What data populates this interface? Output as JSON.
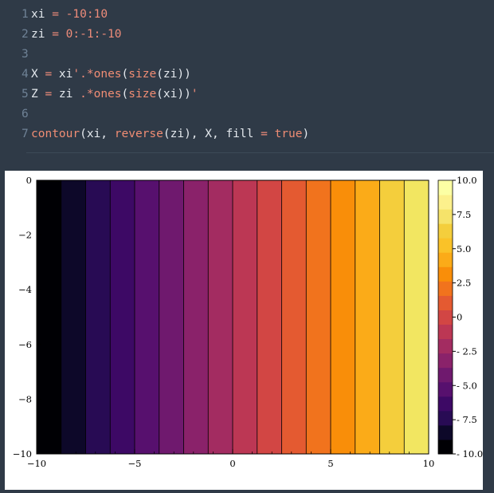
{
  "code": {
    "lines": [
      {
        "n": "1",
        "tokens": [
          {
            "t": "xi ",
            "c": "txt"
          },
          {
            "t": "=",
            "c": "op"
          },
          {
            "t": " ",
            "c": "txt"
          },
          {
            "t": "-10:10",
            "c": "num"
          }
        ]
      },
      {
        "n": "2",
        "tokens": [
          {
            "t": "zi ",
            "c": "txt"
          },
          {
            "t": "=",
            "c": "op"
          },
          {
            "t": " ",
            "c": "txt"
          },
          {
            "t": "0:-1:-10",
            "c": "num"
          }
        ]
      },
      {
        "n": "3",
        "tokens": []
      },
      {
        "n": "4",
        "tokens": [
          {
            "t": "X ",
            "c": "txt"
          },
          {
            "t": "=",
            "c": "op"
          },
          {
            "t": " xi",
            "c": "txt"
          },
          {
            "t": "'.*",
            "c": "op"
          },
          {
            "t": "ones",
            "c": "fn"
          },
          {
            "t": "(",
            "c": "txt"
          },
          {
            "t": "size",
            "c": "fn"
          },
          {
            "t": "(zi))",
            "c": "txt"
          }
        ]
      },
      {
        "n": "5",
        "tokens": [
          {
            "t": "Z ",
            "c": "txt"
          },
          {
            "t": "=",
            "c": "op"
          },
          {
            "t": " zi ",
            "c": "txt"
          },
          {
            "t": ".*",
            "c": "op"
          },
          {
            "t": "ones",
            "c": "fn"
          },
          {
            "t": "(",
            "c": "txt"
          },
          {
            "t": "size",
            "c": "fn"
          },
          {
            "t": "(xi))",
            "c": "txt"
          },
          {
            "t": "'",
            "c": "op"
          }
        ]
      },
      {
        "n": "6",
        "tokens": []
      },
      {
        "n": "7",
        "tokens": [
          {
            "t": "contour",
            "c": "fn"
          },
          {
            "t": "(xi, ",
            "c": "txt"
          },
          {
            "t": "reverse",
            "c": "fn"
          },
          {
            "t": "(zi), X, fill ",
            "c": "txt"
          },
          {
            "t": "=",
            "c": "op"
          },
          {
            "t": " ",
            "c": "txt"
          },
          {
            "t": "true",
            "c": "kw"
          },
          {
            "t": ")",
            "c": "txt"
          }
        ]
      }
    ]
  },
  "chart_data": {
    "type": "heatmap",
    "title": "",
    "xlabel": "",
    "ylabel": "",
    "xlim": [
      -10,
      10
    ],
    "ylim": [
      -10,
      0
    ],
    "x_ticks": [
      -10,
      -5,
      0,
      5,
      10
    ],
    "x_tick_labels": [
      "−10",
      "−5",
      "0",
      "5",
      "10"
    ],
    "y_ticks": [
      0,
      -2,
      -4,
      -6,
      -8,
      -10
    ],
    "y_tick_labels": [
      "0",
      "−2",
      "−4",
      "−6",
      "−8",
      "−10"
    ],
    "contour_boundaries": [
      -8.75,
      -7.5,
      -6.25,
      -5,
      -3.75,
      -2.5,
      -1.25,
      0,
      1.25,
      2.5,
      3.75,
      5,
      6.25,
      7.5,
      8.75
    ],
    "fill_colors": [
      "#000004",
      "#0d0829",
      "#280b54",
      "#3d0965",
      "#57106e",
      "#6f196e",
      "#8a226a",
      "#a32c61",
      "#bc3754",
      "#d24644",
      "#e45a31",
      "#f1731d",
      "#f98e09",
      "#fbab18",
      "#f4ce3c",
      "#f2e661",
      "#fcffa4"
    ],
    "colorbar": {
      "range": [
        -10,
        10
      ],
      "tick_values": [
        10,
        7.5,
        5,
        2.5,
        0,
        -2.5,
        -5,
        -7.5,
        -10
      ],
      "tick_labels": [
        "10.0",
        "7.5",
        "5.0",
        "2.5",
        "0",
        "- 2.5",
        "- 5.0",
        "- 7.5",
        "- 10.0"
      ],
      "colors": [
        "#000004",
        "#0d0829",
        "#280b54",
        "#3d0965",
        "#57106e",
        "#6f196e",
        "#8a226a",
        "#a32c61",
        "#bc3754",
        "#d24644",
        "#e45a31",
        "#f1731d",
        "#f98e09",
        "#fbab18",
        "#fac228",
        "#f4ce3c",
        "#f6e36a",
        "#fcf08c",
        "#fcffa4"
      ]
    },
    "grid": false,
    "legend": "colorbar-right"
  }
}
